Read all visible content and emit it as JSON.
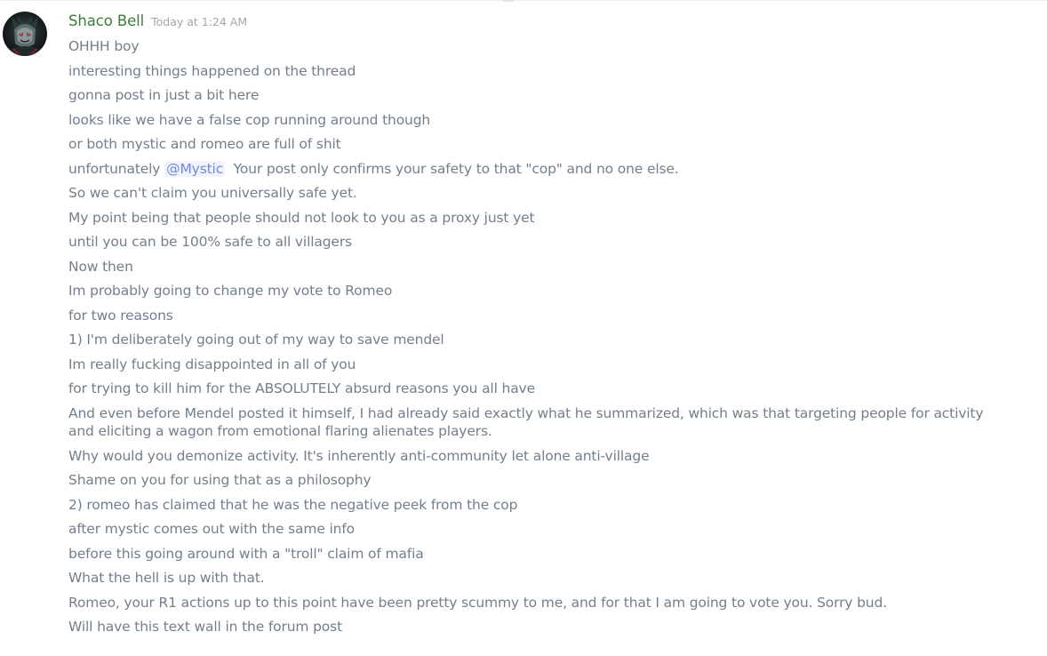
{
  "message_group": {
    "username": "Shaco Bell",
    "timestamp": "Today at 1:24 AM",
    "avatar_icon": "jester-avatar-icon",
    "username_color": "#3e7c3e",
    "text_color": "#737f8d",
    "mention_color": "#7289da",
    "messages": [
      {
        "text": "OHHH boy"
      },
      {
        "text": "interesting things happened on the thread"
      },
      {
        "text": "gonna post in just a bit here"
      },
      {
        "text": "looks like we have a false cop running around though"
      },
      {
        "text": "or both mystic and romeo are full of shit"
      },
      {
        "before": "unfortunately ",
        "mention": "@Mystic",
        "after": "  Your post only confirms your safety to that \"cop\" and no one else."
      },
      {
        "text": "So we can't claim you universally safe yet."
      },
      {
        "text": "My point being that people should not look to you as a proxy just yet"
      },
      {
        "text": "until you can be 100% safe to all villagers"
      },
      {
        "text": "Now then"
      },
      {
        "text": "Im probably going to change my vote to Romeo"
      },
      {
        "text": "for two reasons"
      },
      {
        "text": "1) I'm deliberately going out of my way to save mendel"
      },
      {
        "text": "Im really fucking disappointed in all of you"
      },
      {
        "text": "for trying to kill him for the ABSOLUTELY absurd reasons you all have"
      },
      {
        "text": "And even before Mendel posted it himself, I had already said exactly what he summarized, which was that targeting people for activity and eliciting a wagon from emotional flaring alienates players."
      },
      {
        "text": "Why would you demonize activity. It's inherently anti-community let alone anti-village"
      },
      {
        "text": "Shame on you for using that as a philosophy"
      },
      {
        "text": "2) romeo has claimed that he was the negative peek from the cop"
      },
      {
        "text": "after mystic comes out with the same info"
      },
      {
        "text": "before this going around with a \"troll\" claim of mafia"
      },
      {
        "text": "What the hell is up with that."
      },
      {
        "text": "Romeo, your R1 actions up to this point have been pretty scummy to me, and for that I am going to vote you. Sorry bud."
      },
      {
        "text": "Will have this text wall in the forum post"
      }
    ]
  }
}
